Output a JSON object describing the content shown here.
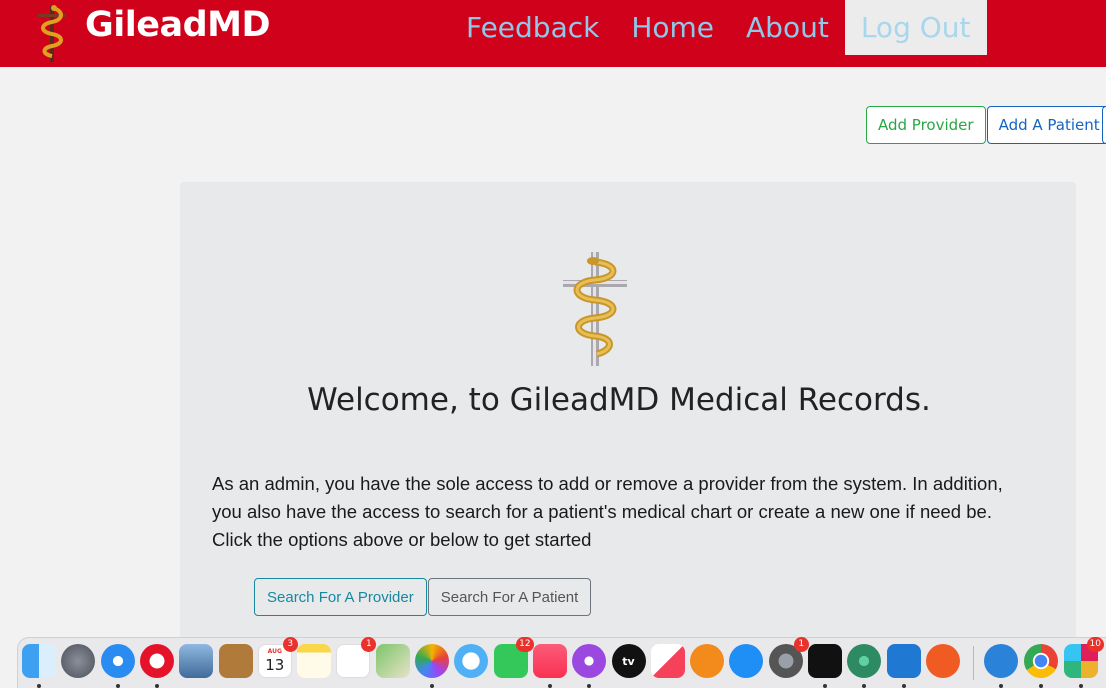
{
  "header": {
    "brand": "GileadMD",
    "nav": [
      {
        "label": "Feedback",
        "active": false
      },
      {
        "label": "Home",
        "active": false
      },
      {
        "label": "About",
        "active": false
      },
      {
        "label": "Log Out",
        "active": true
      }
    ],
    "bg_color": "#d0021b",
    "nav_color": "#8ec9ea"
  },
  "actions": {
    "add_provider": "Add Provider",
    "add_patient": "Add A Patient"
  },
  "main": {
    "welcome": "Welcome, to GileadMD Medical Records.",
    "description_lines": [
      "As an admin, you have the sole access to add or remove a provider from the system. In addition,",
      "you also have the access to search for a patient's medical chart or create a new one if need be.",
      "Click the options above or below to get started"
    ],
    "search_provider": "Search For A Provider",
    "search_patient": "Search For A Patient"
  },
  "dock": {
    "items": [
      {
        "name": "finder-icon",
        "running": true,
        "badge": ""
      },
      {
        "name": "launchpad-icon",
        "running": false,
        "badge": ""
      },
      {
        "name": "safari-icon",
        "running": true,
        "badge": ""
      },
      {
        "name": "opera-icon",
        "running": true,
        "badge": ""
      },
      {
        "name": "preview-icon",
        "running": false,
        "badge": ""
      },
      {
        "name": "contacts-icon",
        "running": false,
        "badge": ""
      },
      {
        "name": "calendar-icon",
        "running": false,
        "badge": "3",
        "month": "AUG",
        "day": "13"
      },
      {
        "name": "notes-icon",
        "running": false,
        "badge": ""
      },
      {
        "name": "reminders-icon",
        "running": false,
        "badge": "1"
      },
      {
        "name": "maps-icon",
        "running": false,
        "badge": ""
      },
      {
        "name": "photos-icon",
        "running": true,
        "badge": ""
      },
      {
        "name": "messages-icon",
        "running": false,
        "badge": ""
      },
      {
        "name": "facetime-icon",
        "running": false,
        "badge": "12"
      },
      {
        "name": "music-icon",
        "running": true,
        "badge": ""
      },
      {
        "name": "podcasts-icon",
        "running": true,
        "badge": ""
      },
      {
        "name": "apple-tv-icon",
        "running": false,
        "badge": "",
        "text": "tv"
      },
      {
        "name": "news-icon",
        "running": false,
        "badge": ""
      },
      {
        "name": "books-icon",
        "running": false,
        "badge": ""
      },
      {
        "name": "app-store-icon",
        "running": false,
        "badge": ""
      },
      {
        "name": "system-preferences-icon",
        "running": false,
        "badge": "1"
      },
      {
        "name": "terminal-icon",
        "running": true,
        "badge": ""
      },
      {
        "name": "atom-icon",
        "running": true,
        "badge": ""
      },
      {
        "name": "vscode-icon",
        "running": true,
        "badge": ""
      },
      {
        "name": "pencil-app-icon",
        "running": false,
        "badge": ""
      },
      {
        "name": "tableplus-icon",
        "running": true,
        "badge": ""
      },
      {
        "name": "chrome-icon",
        "running": true,
        "badge": ""
      },
      {
        "name": "slack-icon",
        "running": true,
        "badge": "10"
      }
    ]
  }
}
